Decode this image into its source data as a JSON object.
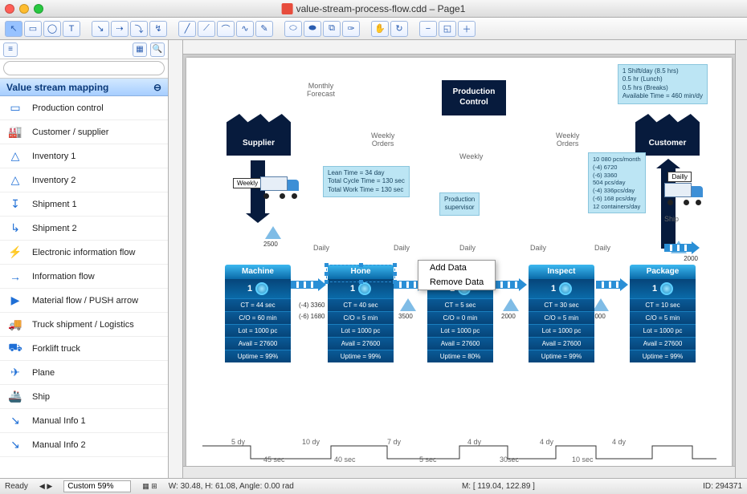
{
  "window": {
    "title": "value-stream-process-flow.cdd – Page1"
  },
  "sidebar": {
    "header": "Value stream mapping",
    "search_placeholder": "",
    "items": [
      {
        "label": "Production control",
        "glyph": "▭"
      },
      {
        "label": "Customer / supplier",
        "glyph": "🏭"
      },
      {
        "label": "Inventory 1",
        "glyph": "△"
      },
      {
        "label": "Inventory 2",
        "glyph": "△"
      },
      {
        "label": "Shipment 1",
        "glyph": "↧"
      },
      {
        "label": "Shipment 2",
        "glyph": "↳"
      },
      {
        "label": "Electronic information flow",
        "glyph": "⚡"
      },
      {
        "label": "Information flow",
        "glyph": "→"
      },
      {
        "label": "Material flow / PUSH arrow",
        "glyph": "▶"
      },
      {
        "label": "Truck shipment / Logistics",
        "glyph": "🚚"
      },
      {
        "label": "Forklift truck",
        "glyph": "⛟"
      },
      {
        "label": "Plane",
        "glyph": "✈"
      },
      {
        "label": "Ship",
        "glyph": "🚢"
      },
      {
        "label": "Manual Info 1",
        "glyph": "↘"
      },
      {
        "label": "Manual Info 2",
        "glyph": "↘"
      }
    ]
  },
  "diagram": {
    "monthly_forecast": "Monthly\nForecast",
    "weekly_orders": "Weekly\nOrders",
    "weekly": "Weekly",
    "production_control": "Production\nControl",
    "supplier": "Supplier",
    "customer": "Customer",
    "ship_weekly": "Weekly",
    "ship_daily": "Dailly",
    "ship_label": "Ship",
    "prod_supervisor": "Production\nsupervisor",
    "daily": "Daily",
    "shift_box": "1 Shift/day (8.5 hrs)\n0.5 hr (Lunch)\n0.5 hrs (Breaks)\nAvailable Time = 460 min/dy",
    "lead_box": "Lean Time = 34 day\nTotal Cycle Time = 130 sec\nTotal Work Time = 130 sec",
    "volume_box": "10 080 pcs/month\n(-4) 6720\n(-6) 3360\n504 pcs/day\n(-4) 336pcs/day\n(-6) 168 pcs/day\n12 containers/day",
    "inv_2500": "2500",
    "inv_3500": "3500",
    "inv_2000a": "2000",
    "inv_2000b": "2000",
    "inv_2000c": "2000",
    "side_3360": "(-4) 3360",
    "side_1680": "(-6) 1680",
    "processes": [
      {
        "name": "Machine",
        "ct": "CT = 44 sec",
        "co": "C/O = 60 min",
        "lot": "Lot = 1000 pc",
        "avail": "Avail = 27600",
        "up": "Uptime = 99%"
      },
      {
        "name": "Hone",
        "ct": "CT = 40 sec",
        "co": "C/O = 5 min",
        "lot": "Lot = 1000 pc",
        "avail": "Avail = 27600",
        "up": "Uptime = 99%"
      },
      {
        "name": "",
        "ct": "CT = 5 sec",
        "co": "C/O = 0 min",
        "lot": "Lot = 1000 pc",
        "avail": "Avail = 27600",
        "up": "Uptime = 80%"
      },
      {
        "name": "Inspect",
        "ct": "CT = 30 sec",
        "co": "C/O = 5 min",
        "lot": "Lot = 1000 pc",
        "avail": "Avail = 27600",
        "up": "Uptime = 99%"
      },
      {
        "name": "Package",
        "ct": "CT = 10 sec",
        "co": "C/O = 5 min",
        "lot": "Lot = 1000 pc",
        "avail": "Avail = 27600",
        "up": "Uptime = 99%"
      }
    ],
    "timeline": [
      {
        "top": "5 dy",
        "bot": "45 sec"
      },
      {
        "top": "10 dy",
        "bot": "40 sec"
      },
      {
        "top": "7 dy",
        "bot": "5 sec"
      },
      {
        "top": "4 dy",
        "bot": "30sec"
      },
      {
        "top": "4 dy",
        "bot": "10 sec"
      },
      {
        "top": "4 dy",
        "bot": ""
      }
    ]
  },
  "context_menu": {
    "add": "Add Data",
    "remove": "Remove Data"
  },
  "status": {
    "ready": "Ready",
    "zoom_label": "Custom 59%",
    "wh": "W: 30.48, H: 61.08, Angle: 0.00 rad",
    "mouse": "M: [ 119.04, 122.89 ]",
    "id": "ID: 294371"
  }
}
